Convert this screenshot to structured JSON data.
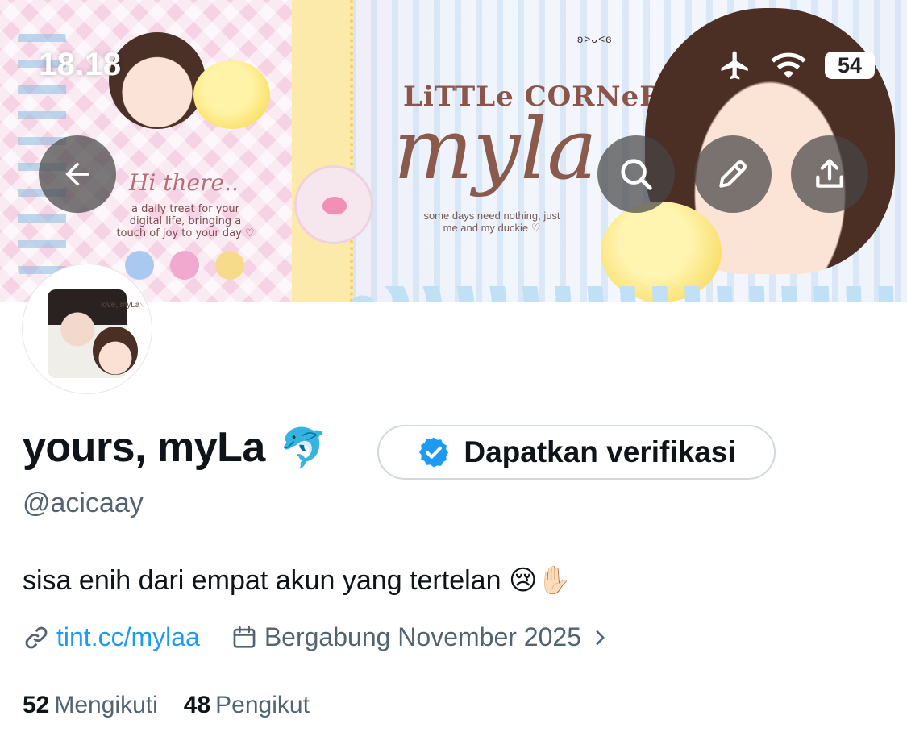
{
  "status_bar": {
    "time": "18.18",
    "battery": "54",
    "icons": [
      "airplane-icon",
      "wifi-icon",
      "battery-icon"
    ]
  },
  "header_banner": {
    "greeting": "Hi there..",
    "tagline": "a daily treat for your digital life, bringing a touch of joy to your day ♡",
    "corner_title": "LiTTLe CORNeR",
    "script_name": "myla",
    "sub_note": "some days need nothing, just me and my duckie ♡",
    "kaomoji": "ʚ˃ᴗ˂ɞ"
  },
  "header_buttons": {
    "back": "back-arrow-icon",
    "search": "search-icon",
    "edit": "pencil-icon",
    "share": "share-icon"
  },
  "avatar": {
    "label": "love, myLa♡"
  },
  "profile": {
    "display_name": "yours, myLa",
    "name_emoji": "🐬",
    "verify_button_label": "Dapatkan verifikasi",
    "handle": "@acicaay",
    "bio_text": "sisa enih dari empat akun yang tertelan",
    "bio_emojis": "😢✋🏻",
    "link": "tint.cc/mylaa",
    "joined": "Bergabung November 2025",
    "following_count": "52",
    "following_label": "Mengikuti",
    "followers_count": "48",
    "followers_label": "Pengikut"
  },
  "colors": {
    "link_blue": "#1d9bf0",
    "secondary_text": "#536471",
    "primary_text": "#0f1419",
    "verified_blue": "#1d9bf0"
  }
}
